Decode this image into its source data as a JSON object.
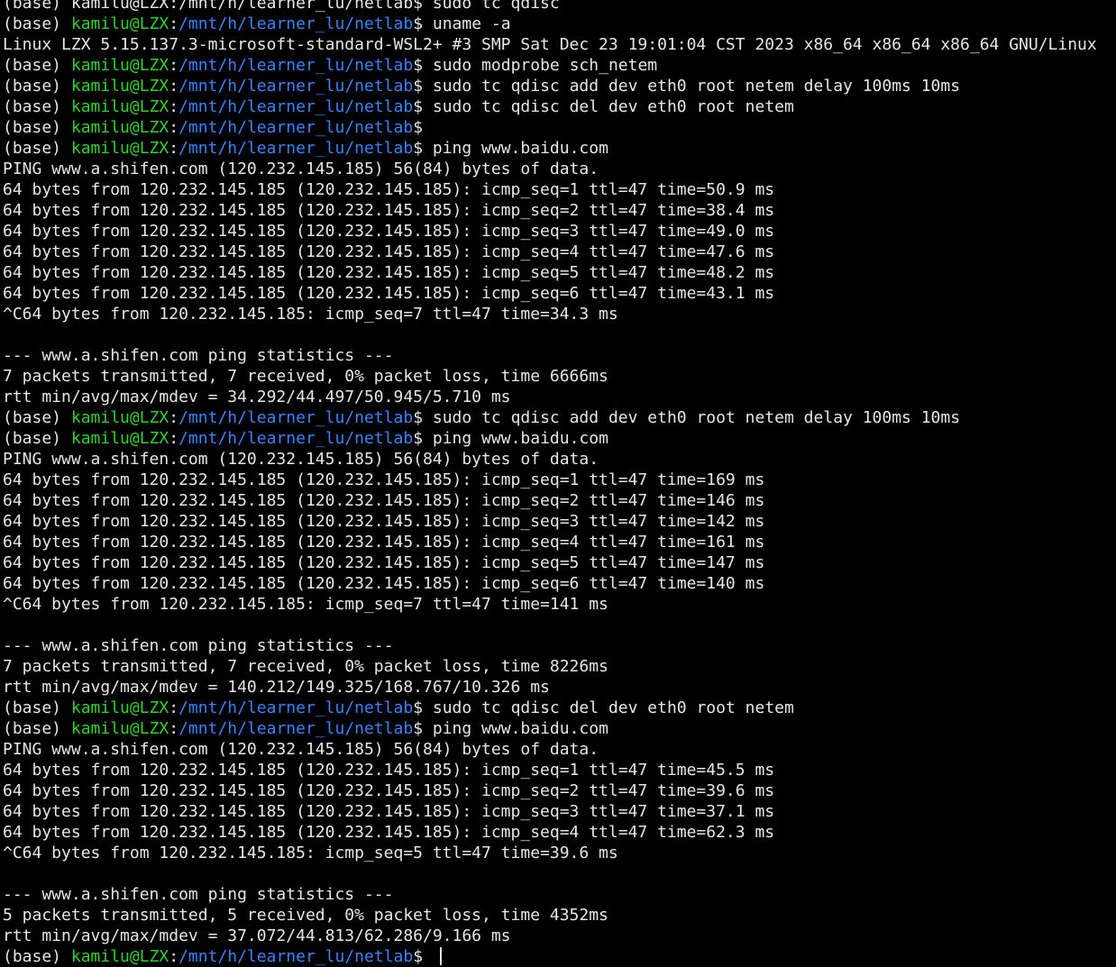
{
  "terminal": {
    "prompt": {
      "env": "(base)",
      "user": "kamilu@LZX",
      "sep": ":",
      "path": "/mnt/h/learner_lu/netlab",
      "symbol": "$"
    },
    "colors": {
      "background": "#000000",
      "text": "#e6e6e6",
      "user": "#2fd22a",
      "path": "#3b82f6"
    },
    "lines": [
      {
        "kind": "output",
        "text": "(base) kamilu@LZX:/mnt/h/learner_lu/netlab$ sudo tc qdisc"
      },
      {
        "kind": "prompt",
        "cmd": "uname -a"
      },
      {
        "kind": "output",
        "text": "Linux LZX 5.15.137.3-microsoft-standard-WSL2+ #3 SMP Sat Dec 23 19:01:04 CST 2023 x86_64 x86_64 x86_64 GNU/Linux"
      },
      {
        "kind": "prompt",
        "cmd": "sudo modprobe sch_netem"
      },
      {
        "kind": "prompt",
        "cmd": "sudo tc qdisc add dev eth0 root netem delay 100ms 10ms"
      },
      {
        "kind": "prompt",
        "cmd": "sudo tc qdisc del dev eth0 root netem"
      },
      {
        "kind": "prompt",
        "cmd": ""
      },
      {
        "kind": "prompt",
        "cmd": "ping www.baidu.com"
      },
      {
        "kind": "output",
        "text": "PING www.a.shifen.com (120.232.145.185) 56(84) bytes of data."
      },
      {
        "kind": "output",
        "text": "64 bytes from 120.232.145.185 (120.232.145.185): icmp_seq=1 ttl=47 time=50.9 ms"
      },
      {
        "kind": "output",
        "text": "64 bytes from 120.232.145.185 (120.232.145.185): icmp_seq=2 ttl=47 time=38.4 ms"
      },
      {
        "kind": "output",
        "text": "64 bytes from 120.232.145.185 (120.232.145.185): icmp_seq=3 ttl=47 time=49.0 ms"
      },
      {
        "kind": "output",
        "text": "64 bytes from 120.232.145.185 (120.232.145.185): icmp_seq=4 ttl=47 time=47.6 ms"
      },
      {
        "kind": "output",
        "text": "64 bytes from 120.232.145.185 (120.232.145.185): icmp_seq=5 ttl=47 time=48.2 ms"
      },
      {
        "kind": "output",
        "text": "64 bytes from 120.232.145.185 (120.232.145.185): icmp_seq=6 ttl=47 time=43.1 ms"
      },
      {
        "kind": "output",
        "text": "^C64 bytes from 120.232.145.185: icmp_seq=7 ttl=47 time=34.3 ms"
      },
      {
        "kind": "output",
        "text": ""
      },
      {
        "kind": "output",
        "text": "--- www.a.shifen.com ping statistics ---"
      },
      {
        "kind": "output",
        "text": "7 packets transmitted, 7 received, 0% packet loss, time 6666ms"
      },
      {
        "kind": "output",
        "text": "rtt min/avg/max/mdev = 34.292/44.497/50.945/5.710 ms"
      },
      {
        "kind": "prompt",
        "cmd": "sudo tc qdisc add dev eth0 root netem delay 100ms 10ms"
      },
      {
        "kind": "prompt",
        "cmd": "ping www.baidu.com"
      },
      {
        "kind": "output",
        "text": "PING www.a.shifen.com (120.232.145.185) 56(84) bytes of data."
      },
      {
        "kind": "output",
        "text": "64 bytes from 120.232.145.185 (120.232.145.185): icmp_seq=1 ttl=47 time=169 ms"
      },
      {
        "kind": "output",
        "text": "64 bytes from 120.232.145.185 (120.232.145.185): icmp_seq=2 ttl=47 time=146 ms"
      },
      {
        "kind": "output",
        "text": "64 bytes from 120.232.145.185 (120.232.145.185): icmp_seq=3 ttl=47 time=142 ms"
      },
      {
        "kind": "output",
        "text": "64 bytes from 120.232.145.185 (120.232.145.185): icmp_seq=4 ttl=47 time=161 ms"
      },
      {
        "kind": "output",
        "text": "64 bytes from 120.232.145.185 (120.232.145.185): icmp_seq=5 ttl=47 time=147 ms"
      },
      {
        "kind": "output",
        "text": "64 bytes from 120.232.145.185 (120.232.145.185): icmp_seq=6 ttl=47 time=140 ms"
      },
      {
        "kind": "output",
        "text": "^C64 bytes from 120.232.145.185: icmp_seq=7 ttl=47 time=141 ms"
      },
      {
        "kind": "output",
        "text": ""
      },
      {
        "kind": "output",
        "text": "--- www.a.shifen.com ping statistics ---"
      },
      {
        "kind": "output",
        "text": "7 packets transmitted, 7 received, 0% packet loss, time 8226ms"
      },
      {
        "kind": "output",
        "text": "rtt min/avg/max/mdev = 140.212/149.325/168.767/10.326 ms"
      },
      {
        "kind": "prompt",
        "cmd": "sudo tc qdisc del dev eth0 root netem"
      },
      {
        "kind": "prompt",
        "cmd": "ping www.baidu.com"
      },
      {
        "kind": "output",
        "text": "PING www.a.shifen.com (120.232.145.185) 56(84) bytes of data."
      },
      {
        "kind": "output",
        "text": "64 bytes from 120.232.145.185 (120.232.145.185): icmp_seq=1 ttl=47 time=45.5 ms"
      },
      {
        "kind": "output",
        "text": "64 bytes from 120.232.145.185 (120.232.145.185): icmp_seq=2 ttl=47 time=39.6 ms"
      },
      {
        "kind": "output",
        "text": "64 bytes from 120.232.145.185 (120.232.145.185): icmp_seq=3 ttl=47 time=37.1 ms"
      },
      {
        "kind": "output",
        "text": "64 bytes from 120.232.145.185 (120.232.145.185): icmp_seq=4 ttl=47 time=62.3 ms"
      },
      {
        "kind": "output",
        "text": "^C64 bytes from 120.232.145.185: icmp_seq=5 ttl=47 time=39.6 ms"
      },
      {
        "kind": "output",
        "text": ""
      },
      {
        "kind": "output",
        "text": "--- www.a.shifen.com ping statistics ---"
      },
      {
        "kind": "output",
        "text": "5 packets transmitted, 5 received, 0% packet loss, time 4352ms"
      },
      {
        "kind": "output",
        "text": "rtt min/avg/max/mdev = 37.072/44.813/62.286/9.166 ms"
      },
      {
        "kind": "prompt",
        "cmd": "",
        "cursor": true
      }
    ]
  }
}
